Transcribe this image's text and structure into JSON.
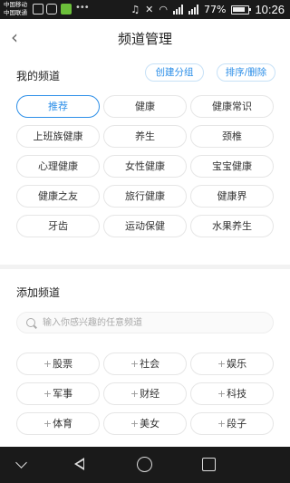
{
  "status_bar": {
    "carrier1": "中国移动",
    "carrier2": "中国联通",
    "battery_percent": "77%",
    "time": "10:26"
  },
  "header": {
    "title": "频道管理"
  },
  "my_channels": {
    "title": "我的频道",
    "create_group": "创建分组",
    "sort_delete": "排序/删除",
    "items": [
      "推荐",
      "健康",
      "健康常识",
      "上班族健康",
      "养生",
      "颈椎",
      "心理健康",
      "女性健康",
      "宝宝健康",
      "健康之友",
      "旅行健康",
      "健康界",
      "牙齿",
      "运动保健",
      "水果养生"
    ]
  },
  "add_channels": {
    "title": "添加频道",
    "search_placeholder": "输入你感兴趣的任意频道",
    "plus": "+",
    "items": [
      "股票",
      "社会",
      "娱乐",
      "军事",
      "财经",
      "科技",
      "体育",
      "美女",
      "段子"
    ]
  }
}
